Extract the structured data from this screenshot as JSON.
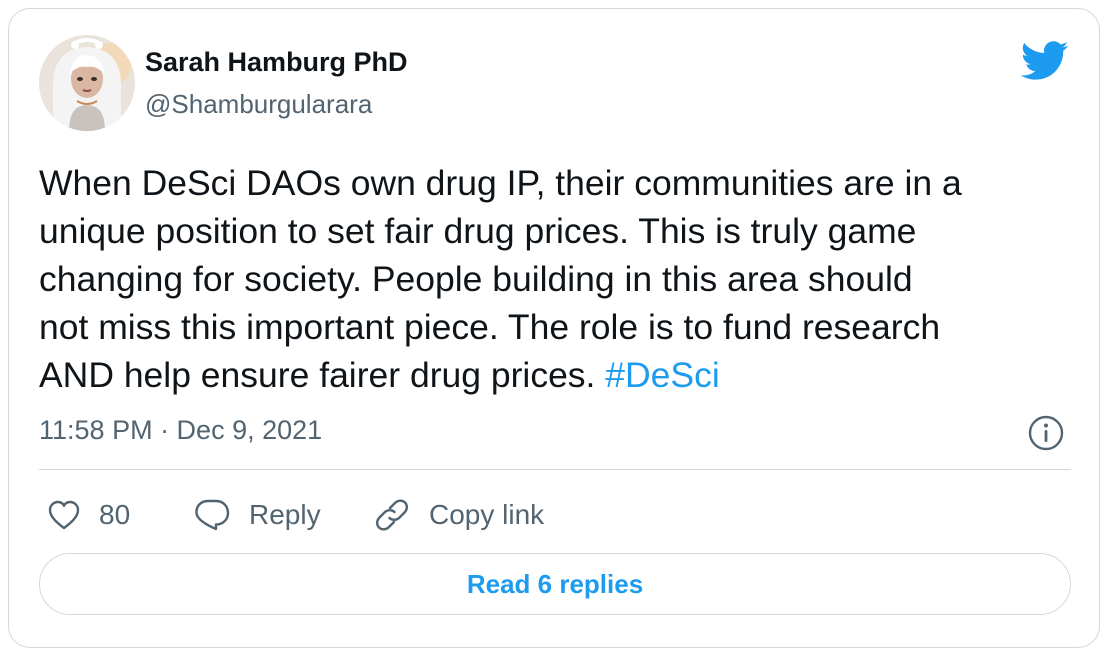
{
  "author": {
    "name": "Sarah Hamburg PhD",
    "handle": "@Shamburgularara",
    "avatar_icon": "avatar-illustration"
  },
  "brand": {
    "icon": "twitter-bird-icon",
    "color": "#1d9bf0"
  },
  "tweet": {
    "lines": [
      "When DeSci DAOs own drug IP, their communities are in a",
      "unique position to set fair drug prices. This is truly game",
      "changing for society. People building in this area should",
      "not miss this important piece. The role is to fund research",
      "AND help ensure fairer drug prices. "
    ],
    "hashtag": "#DeSci",
    "timestamp": "11:58 PM · Dec 9, 2021"
  },
  "actions": {
    "like_icon": "heart-icon",
    "like_count": "80",
    "reply_icon": "speech-bubble-icon",
    "reply_label": "Reply",
    "copy_icon": "link-icon",
    "copy_label": "Copy link",
    "info_icon": "info-icon"
  },
  "footer": {
    "read_replies_label": "Read 6 replies"
  },
  "colors": {
    "text_primary": "#0f1419",
    "text_secondary": "#536471",
    "border": "#cfd9de",
    "accent": "#1d9bf0"
  }
}
